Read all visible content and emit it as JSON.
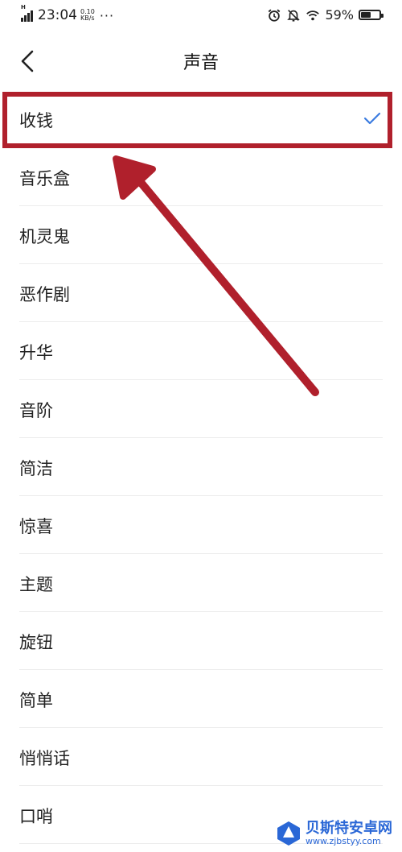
{
  "status_bar": {
    "time": "23:04",
    "net_speed_value": "0.10",
    "net_speed_unit": "KB/s",
    "more": "···",
    "network": "H",
    "battery_percent": "59%",
    "battery_level": 0.59
  },
  "header": {
    "title": "声音"
  },
  "sounds": [
    {
      "label": "收钱",
      "selected": true
    },
    {
      "label": "音乐盒",
      "selected": false
    },
    {
      "label": "机灵鬼",
      "selected": false
    },
    {
      "label": "恶作剧",
      "selected": false
    },
    {
      "label": "升华",
      "selected": false
    },
    {
      "label": "音阶",
      "selected": false
    },
    {
      "label": "简洁",
      "selected": false
    },
    {
      "label": "惊喜",
      "selected": false
    },
    {
      "label": "主题",
      "selected": false
    },
    {
      "label": "旋钮",
      "selected": false
    },
    {
      "label": "简单",
      "selected": false
    },
    {
      "label": "悄悄话",
      "selected": false
    },
    {
      "label": "口哨",
      "selected": false
    }
  ],
  "annotation": {
    "color": "#b0202c"
  },
  "watermark": {
    "name": "贝斯特安卓网",
    "url": "www.zjbstyy.com"
  },
  "colors": {
    "accent": "#3a7be0",
    "annotation": "#b0202c"
  }
}
